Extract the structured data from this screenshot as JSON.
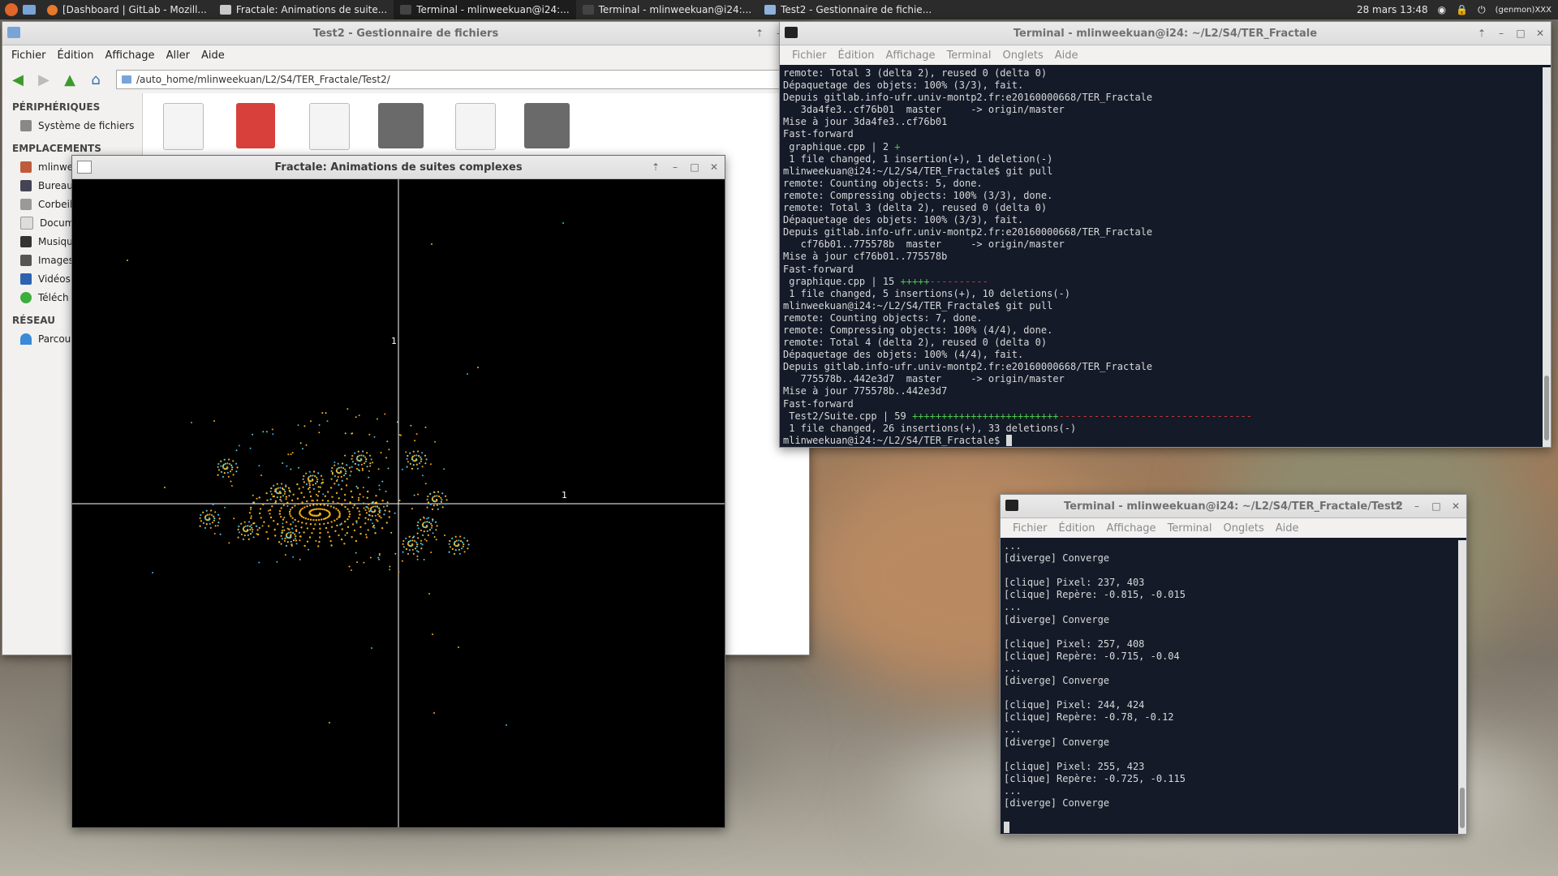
{
  "panel": {
    "tasks": [
      {
        "label": "[Dashboard | GitLab - Mozill..."
      },
      {
        "label": "Fractale: Animations de suite..."
      },
      {
        "label": "Terminal - mlinweekuan@i24:..."
      },
      {
        "label": "Terminal - mlinweekuan@i24:..."
      },
      {
        "label": "Test2 - Gestionnaire de fichie..."
      }
    ],
    "clock": "28 mars 13:48",
    "user": "(genmon)XXX"
  },
  "file_manager": {
    "title": "Test2 - Gestionnaire de fichiers",
    "menu": [
      "Fichier",
      "Édition",
      "Affichage",
      "Aller",
      "Aide"
    ],
    "path": "/auto_home/mlinweekuan/L2/S4/TER_Fractale/Test2/",
    "sections": {
      "devices": "PÉRIPHÉRIQUES",
      "places": "EMPLACEMENTS",
      "network": "RÉSEAU"
    },
    "devices": [
      "Système de fichiers"
    ],
    "places": [
      "mlinwee",
      "Bureau",
      "Corbeil",
      "Docume",
      "Musique",
      "Images",
      "Vidéos",
      "Téléch"
    ],
    "network": [
      "Parcour"
    ]
  },
  "fractal": {
    "title": "Fractale: Animations de suites complexes",
    "axis_label_y": "1",
    "axis_label_x": "1"
  },
  "term1": {
    "title": "Terminal - mlinweekuan@i24: ~/L2/S4/TER_Fractale",
    "menu": [
      "Fichier",
      "Édition",
      "Affichage",
      "Terminal",
      "Onglets",
      "Aide"
    ],
    "lines": [
      "remote: Total 3 (delta 2), reused 0 (delta 0)",
      "Dépaquetage des objets: 100% (3/3), fait.",
      "Depuis gitlab.info-ufr.univ-montp2.fr:e20160000668/TER_Fractale",
      "   3da4fe3..cf76b01  master     -> origin/master",
      "Mise à jour 3da4fe3..cf76b01",
      "Fast-forward",
      " graphique.cpp | 2 +",
      " 1 file changed, 1 insertion(+), 1 deletion(-)",
      "mlinweekuan@i24:~/L2/S4/TER_Fractale$ git pull",
      "remote: Counting objects: 5, done.",
      "remote: Compressing objects: 100% (3/3), done.",
      "remote: Total 3 (delta 2), reused 0 (delta 0)",
      "Dépaquetage des objets: 100% (3/3), fait.",
      "Depuis gitlab.info-ufr.univ-montp2.fr:e20160000668/TER_Fractale",
      "   cf76b01..775578b  master     -> origin/master",
      "Mise à jour cf76b01..775578b",
      "Fast-forward",
      " graphique.cpp | 15 +++++",
      " 1 file changed, 5 insertions(+), 10 deletions(-)",
      "mlinweekuan@i24:~/L2/S4/TER_Fractale$ git pull",
      "remote: Counting objects: 7, done.",
      "remote: Compressing objects: 100% (4/4), done.",
      "remote: Total 4 (delta 2), reused 0 (delta 0)",
      "Dépaquetage des objets: 100% (4/4), fait.",
      "Depuis gitlab.info-ufr.univ-montp2.fr:e20160000668/TER_Fractale",
      "   775578b..442e3d7  master     -> origin/master",
      "Mise à jour 775578b..442e3d7",
      "Fast-forward",
      " Test2/Suite.cpp | 59 +++++++++++++++++++++++++",
      " 1 file changed, 26 insertions(+), 33 deletions(-)",
      "mlinweekuan@i24:~/L2/S4/TER_Fractale$ "
    ]
  },
  "term2": {
    "title": "Terminal - mlinweekuan@i24: ~/L2/S4/TER_Fractale/Test2",
    "menu": [
      "Fichier",
      "Édition",
      "Affichage",
      "Terminal",
      "Onglets",
      "Aide"
    ],
    "lines": [
      "...",
      "[diverge] Converge",
      "",
      "[clique] Pixel: 237, 403",
      "[clique] Repère: -0.815, -0.015",
      "...",
      "[diverge] Converge",
      "",
      "[clique] Pixel: 257, 408",
      "[clique] Repère: -0.715, -0.04",
      "...",
      "[diverge] Converge",
      "",
      "[clique] Pixel: 244, 424",
      "[clique] Repère: -0.78, -0.12",
      "...",
      "[diverge] Converge",
      "",
      "[clique] Pixel: 255, 423",
      "[clique] Repère: -0.725, -0.115",
      "...",
      "[diverge] Converge"
    ]
  }
}
